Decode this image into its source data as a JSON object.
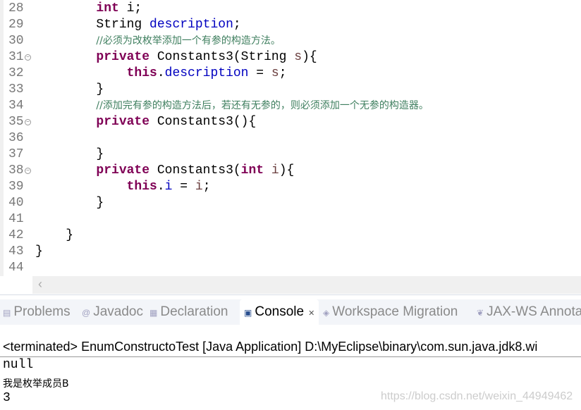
{
  "editor": {
    "lines": [
      {
        "n": "28",
        "fold": false,
        "indent": "        ",
        "parts": [
          [
            "kw",
            "int"
          ],
          [
            "",
            ""
          ],
          [
            "",
            " i;"
          ]
        ]
      },
      {
        "n": "29",
        "fold": false,
        "indent": "        ",
        "parts": [
          [
            "",
            "String "
          ],
          [
            "fd",
            "description"
          ],
          [
            "",
            ";"
          ]
        ]
      },
      {
        "n": "30",
        "fold": false,
        "indent": "        ",
        "parts": [
          [
            "cm",
            "//必须为改枚举添加一个有参的构造方法。"
          ]
        ]
      },
      {
        "n": "31",
        "fold": true,
        "indent": "        ",
        "parts": [
          [
            "kw",
            "private"
          ],
          [
            "",
            " Constants3(String "
          ],
          [
            "pm",
            "s"
          ],
          [
            "",
            "){"
          ]
        ]
      },
      {
        "n": "32",
        "fold": false,
        "indent": "            ",
        "parts": [
          [
            "kw",
            "this"
          ],
          [
            "",
            "."
          ],
          [
            "fd",
            "description"
          ],
          [
            "",
            " = "
          ],
          [
            "pm",
            "s"
          ],
          [
            "",
            ";"
          ]
        ]
      },
      {
        "n": "33",
        "fold": false,
        "indent": "        ",
        "parts": [
          [
            "",
            "}"
          ]
        ]
      },
      {
        "n": "34",
        "fold": false,
        "indent": "        ",
        "parts": [
          [
            "cm",
            "//添加完有参的构造方法后，若还有无参的，则必须添加一个无参的构造器。"
          ]
        ]
      },
      {
        "n": "35",
        "fold": true,
        "indent": "        ",
        "parts": [
          [
            "kw",
            "private"
          ],
          [
            "",
            " Constants3(){"
          ]
        ]
      },
      {
        "n": "36",
        "fold": false,
        "indent": "",
        "parts": []
      },
      {
        "n": "37",
        "fold": false,
        "indent": "        ",
        "parts": [
          [
            "",
            "}"
          ]
        ]
      },
      {
        "n": "38",
        "fold": true,
        "indent": "        ",
        "parts": [
          [
            "kw",
            "private"
          ],
          [
            "",
            " Constants3("
          ],
          [
            "kw",
            "int"
          ],
          [
            "",
            " "
          ],
          [
            "pm",
            "i"
          ],
          [
            "",
            "){"
          ]
        ]
      },
      {
        "n": "39",
        "fold": false,
        "indent": "            ",
        "parts": [
          [
            "kw",
            "this"
          ],
          [
            "",
            "."
          ],
          [
            "fd",
            "i"
          ],
          [
            "",
            " = "
          ],
          [
            "pm",
            "i"
          ],
          [
            "",
            ";"
          ]
        ]
      },
      {
        "n": "40",
        "fold": false,
        "indent": "        ",
        "parts": [
          [
            "",
            "}"
          ]
        ]
      },
      {
        "n": "41",
        "fold": false,
        "indent": "",
        "parts": []
      },
      {
        "n": "42",
        "fold": false,
        "indent": "    ",
        "parts": [
          [
            "",
            "}"
          ]
        ]
      },
      {
        "n": "43",
        "fold": false,
        "indent": "",
        "parts": [
          [
            "",
            "}"
          ]
        ]
      },
      {
        "n": "44",
        "fold": false,
        "indent": "",
        "parts": []
      }
    ],
    "scroll_left_icon": "chevron-left-icon"
  },
  "tabs": [
    {
      "label": "Problems",
      "icon": "problems-icon",
      "active": false
    },
    {
      "label": "Javadoc",
      "icon": "at-icon",
      "active": false
    },
    {
      "label": "Declaration",
      "icon": "declaration-icon",
      "active": false
    },
    {
      "label": "Console",
      "icon": "console-icon",
      "active": true
    },
    {
      "label": "Workspace Migration",
      "icon": "migration-icon",
      "active": false
    },
    {
      "label": "JAX-WS Annota",
      "icon": "jaxws-icon",
      "active": false
    }
  ],
  "console": {
    "header": "<terminated> EnumConstructoTest [Java Application] D:\\MyEclipse\\binary\\com.sun.java.jdk8.wi",
    "output": [
      "null",
      "我是枚举成员B",
      "3"
    ]
  },
  "watermark": "https://blog.csdn.net/weixin_44949462",
  "colors": {
    "keyword": "#7f0055",
    "field": "#0000c0",
    "comment": "#3f7f5f",
    "param": "#6a3e3e"
  }
}
